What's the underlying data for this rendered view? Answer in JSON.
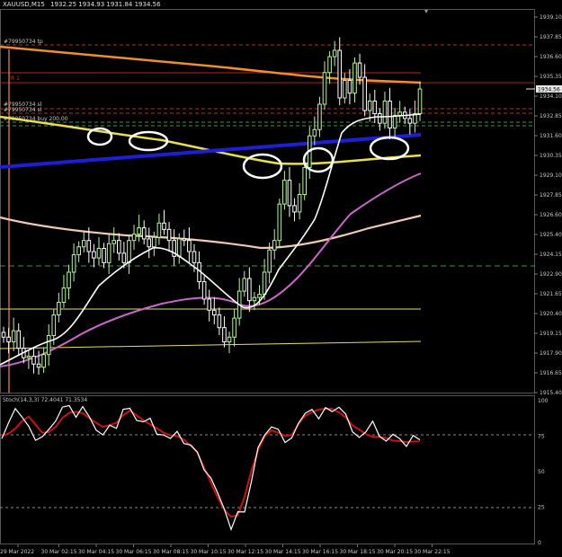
{
  "window": {
    "title": "XAUUSD,M15",
    "ohlc": "1932.25 1934.93 1931.84 1934.56"
  },
  "price_tag": "1934.56",
  "order_labels": {
    "tp": "#79950734 tp",
    "stop": "#79950734 sl",
    "stop2": "#79950734 sl",
    "buy": "#79950734 buy 200.00",
    "r1": "R 1"
  },
  "colors": {
    "background": "#000000",
    "bull_candle": "#b9f59b",
    "bear_candle": "#ffffff",
    "fast_ma": "#ffffff",
    "slow_ma": "#cc66cc",
    "pink_ma": "#f2c8b4",
    "yellow_ma": "#e8e04a",
    "orange_ma": "#ee8f2a",
    "blue_trend": "#1e1ed8",
    "stoch_main": "#ffffff",
    "stoch_signal": "#cc1111"
  },
  "stoch_label": "Stoch(14,3,3) 72.4041 71.3534",
  "chart_data": {
    "type": "candlestick",
    "symbol": "XAUUSD",
    "timeframe": "M15",
    "ylim": [
      1915.4,
      1939.1
    ],
    "price_ticks": [
      "1939.10",
      "1937.85",
      "1936.60",
      "1935.35",
      "1934.10",
      "1932.85",
      "1931.60",
      "1930.35",
      "1929.10",
      "1927.85",
      "1926.60",
      "1925.40",
      "1924.15",
      "1922.90",
      "1921.65",
      "1920.40",
      "1919.15",
      "1917.90",
      "1916.65",
      "1915.40"
    ],
    "time_ticks": [
      "29 Mar 2022",
      "30 Mar 02:15",
      "30 Mar 04:15",
      "30 Mar 06:15",
      "30 Mar 08:15",
      "30 Mar 10:15",
      "30 Mar 12:15",
      "30 Mar 14:15",
      "30 Mar 16:15",
      "30 Mar 18:15",
      "30 Mar 20:15",
      "30 Mar 22:15"
    ],
    "closes": [
      1918.9,
      1918.6,
      1919.3,
      1918.2,
      1917.6,
      1917.7,
      1917.2,
      1917.0,
      1917.8,
      1919.0,
      1920.3,
      1921.1,
      1922.0,
      1923.0,
      1924.1,
      1924.6,
      1925.0,
      1924.3,
      1923.9,
      1924.5,
      1923.6,
      1924.8,
      1925.0,
      1924.2,
      1923.6,
      1925.0,
      1925.4,
      1925.8,
      1925.1,
      1924.6,
      1925.2,
      1926.1,
      1925.7,
      1925.0,
      1924.0,
      1925.1,
      1925.0,
      1924.3,
      1923.6,
      1922.4,
      1921.3,
      1920.6,
      1920.3,
      1919.5,
      1918.6,
      1918.9,
      1920.1,
      1921.8,
      1922.6,
      1921.2,
      1921.4,
      1921.6,
      1923.0,
      1924.4,
      1925.0,
      1927.3,
      1928.8,
      1927.2,
      1926.8,
      1927.9,
      1929.6,
      1931.6,
      1932.0,
      1933.6,
      1935.6,
      1936.6,
      1937.0,
      1934.0,
      1935.1,
      1934.3,
      1936.2,
      1935.3,
      1933.2,
      1933.8,
      1933.0,
      1932.4,
      1933.8,
      1932.1,
      1932.9,
      1933.1,
      1932.7,
      1932.4,
      1933.0,
      1934.56
    ],
    "stochastic": {
      "ylim": [
        0,
        100
      ],
      "levels": [
        75,
        25
      ],
      "ticks": [
        "100",
        "75",
        "50",
        "25",
        "0"
      ],
      "main": [
        73.2,
        84.4,
        94.4,
        88.5,
        81.9,
        72.1,
        74.6,
        79.9,
        85.7,
        95.5,
        96.6,
        88.3,
        95.8,
        88.5,
        79.2,
        75.9,
        82.7,
        80.5,
        94.0,
        94.6,
        86.1,
        85.1,
        87.6,
        76.3,
        75.8,
        73.4,
        78.4,
        69.8,
        68.8,
        63.8,
        51.2,
        45.6,
        35.1,
        23.6,
        9.3,
        21.8,
        21.6,
        42.7,
        67.0,
        75.9,
        81.5,
        79.9,
        70.5,
        73.8,
        84.2,
        91.2,
        93.8,
        87.2,
        95.1,
        92.3,
        95.4,
        90.5,
        78.1,
        74.1,
        78.1,
        85.6,
        74.9,
        71.5,
        76.3,
        73.2,
        67.8,
        75.5,
        72.4
      ],
      "signal": [
        75.3,
        76.8,
        80.3,
        85.6,
        88.8,
        83.1,
        77.4,
        77.9,
        81.6,
        87.9,
        91.5,
        92.1,
        91.2,
        87.6,
        84.3,
        81.6,
        82.8,
        84.4,
        89.8,
        93.1,
        89.6,
        86.2,
        83.3,
        80.6,
        77.4,
        75.7,
        75.0,
        72.5,
        68.4,
        63.4,
        52.9,
        42.4,
        31.9,
        23.0,
        18.2,
        19.3,
        32.4,
        50.5,
        65.2,
        75.1,
        79.1,
        77.4,
        75.2,
        75.9,
        83.7,
        89.4,
        91.9,
        93.8,
        94.3,
        94.2,
        91.8,
        88.2,
        82.6,
        79.6,
        76.4,
        74.6,
        74.5,
        73.7,
        71.9,
        71.5,
        70.9,
        71.2,
        71.4
      ]
    }
  }
}
